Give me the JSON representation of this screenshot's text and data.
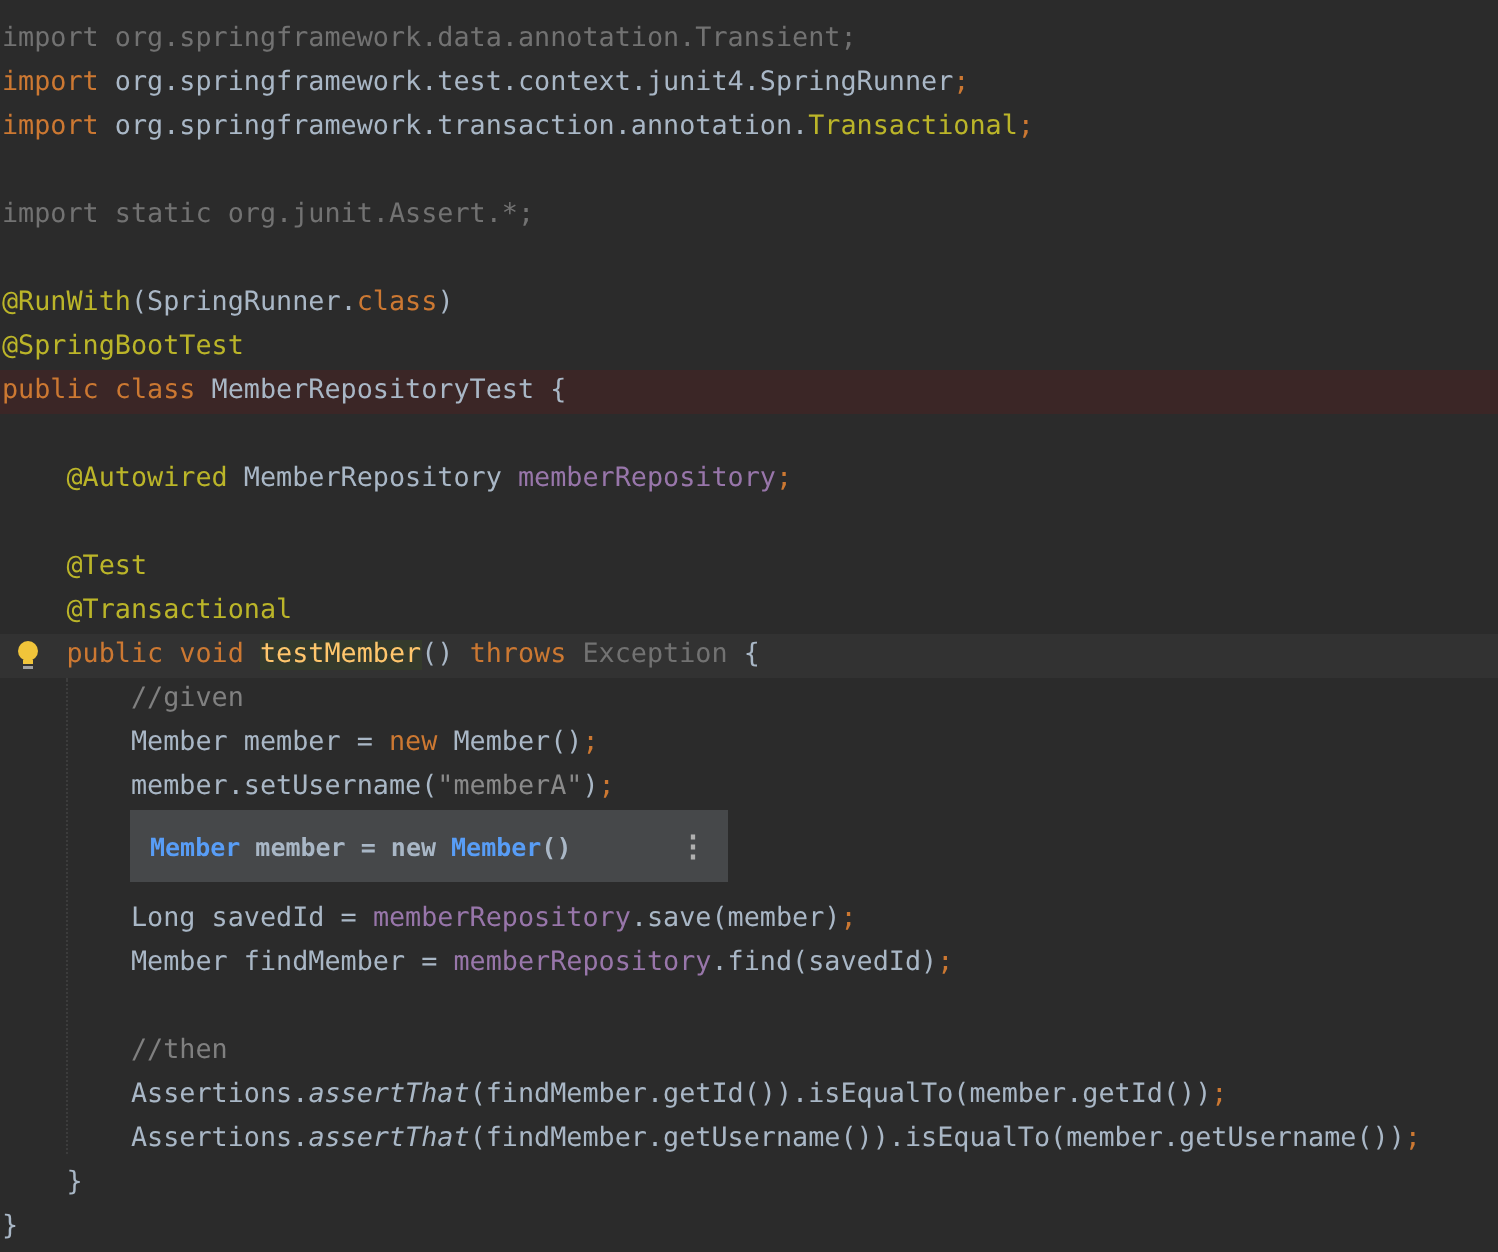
{
  "editor": {
    "lines": [
      {
        "kind": "code",
        "tokens": [
          {
            "kind": "unused",
            "text": "import org.springframework.data.annotation.Transient;"
          }
        ]
      },
      {
        "kind": "code",
        "tokens": [
          {
            "kind": "keyword",
            "text": "import"
          },
          {
            "kind": "plain",
            "text": " org.springframework.test.context.junit4.SpringRunner"
          },
          {
            "kind": "keyword",
            "text": ";"
          }
        ]
      },
      {
        "kind": "code",
        "tokens": [
          {
            "kind": "keyword",
            "text": "import"
          },
          {
            "kind": "plain",
            "text": " org.springframework.transaction.annotation."
          },
          {
            "kind": "class-ref",
            "text": "Transactional"
          },
          {
            "kind": "keyword",
            "text": ";"
          }
        ]
      },
      {
        "kind": "blank"
      },
      {
        "kind": "code",
        "tokens": [
          {
            "kind": "unused",
            "text": "import static org.junit.Assert.*;"
          }
        ]
      },
      {
        "kind": "blank"
      },
      {
        "kind": "code",
        "tokens": [
          {
            "kind": "annotation",
            "text": "@RunWith"
          },
          {
            "kind": "plain",
            "text": "(SpringRunner."
          },
          {
            "kind": "keyword",
            "text": "class"
          },
          {
            "kind": "plain",
            "text": ")"
          }
        ]
      },
      {
        "kind": "code",
        "tokens": [
          {
            "kind": "annotation",
            "text": "@SpringBootTest"
          }
        ]
      },
      {
        "kind": "error-line",
        "tokens": [
          {
            "kind": "keyword",
            "text": "public class"
          },
          {
            "kind": "plain",
            "text": " MemberRepositoryTest {"
          }
        ]
      },
      {
        "kind": "blank"
      },
      {
        "kind": "code",
        "tokens": [
          {
            "kind": "annotation",
            "text": "    @Autowired"
          },
          {
            "kind": "plain",
            "text": " MemberRepository "
          },
          {
            "kind": "field",
            "text": "memberRepository"
          },
          {
            "kind": "keyword",
            "text": ";"
          }
        ]
      },
      {
        "kind": "blank"
      },
      {
        "kind": "code",
        "tokens": [
          {
            "kind": "annotation",
            "text": "    @Test"
          }
        ]
      },
      {
        "kind": "code",
        "tokens": [
          {
            "kind": "annotation",
            "text": "    @Transactional"
          }
        ]
      },
      {
        "kind": "current-line",
        "tokens": [
          {
            "kind": "keyword",
            "text": "    public void "
          },
          {
            "kind": "method-declaration",
            "text": "testMember"
          },
          {
            "kind": "plain",
            "text": "() "
          },
          {
            "kind": "keyword",
            "text": "throws "
          },
          {
            "kind": "unused",
            "text": "Exception"
          },
          {
            "kind": "plain",
            "text": " {"
          }
        ]
      },
      {
        "kind": "code",
        "tokens": [
          {
            "kind": "comment",
            "text": "        //given"
          }
        ]
      },
      {
        "kind": "code",
        "tokens": [
          {
            "kind": "plain",
            "text": "        Member member = "
          },
          {
            "kind": "keyword",
            "text": "new"
          },
          {
            "kind": "plain",
            "text": " Member()"
          },
          {
            "kind": "keyword",
            "text": ";"
          }
        ]
      },
      {
        "kind": "code",
        "tokens": [
          {
            "kind": "plain",
            "text": "        member.setUsername("
          },
          {
            "kind": "string",
            "text": "\"memberA\""
          },
          {
            "kind": "plain",
            "text": ")"
          },
          {
            "kind": "keyword",
            "text": ";"
          }
        ]
      },
      {
        "kind": "blank"
      },
      {
        "kind": "blank"
      },
      {
        "kind": "code",
        "tokens": [
          {
            "kind": "plain",
            "text": "        Long savedId = "
          },
          {
            "kind": "field",
            "text": "memberRepository"
          },
          {
            "kind": "plain",
            "text": ".save(member)"
          },
          {
            "kind": "keyword",
            "text": ";"
          }
        ]
      },
      {
        "kind": "code",
        "tokens": [
          {
            "kind": "plain",
            "text": "        Member findMember = "
          },
          {
            "kind": "field",
            "text": "memberRepository"
          },
          {
            "kind": "plain",
            "text": ".find(savedId)"
          },
          {
            "kind": "keyword",
            "text": ";"
          }
        ]
      },
      {
        "kind": "blank"
      },
      {
        "kind": "code",
        "tokens": [
          {
            "kind": "comment",
            "text": "        //then"
          }
        ]
      },
      {
        "kind": "code",
        "tokens": [
          {
            "kind": "plain",
            "text": "        Assertions."
          },
          {
            "kind": "static-call",
            "text": "assertThat"
          },
          {
            "kind": "plain",
            "text": "(findMember.getId()).isEqualTo(member.getId())"
          },
          {
            "kind": "keyword",
            "text": ";"
          }
        ]
      },
      {
        "kind": "code",
        "tokens": [
          {
            "kind": "plain",
            "text": "        Assertions."
          },
          {
            "kind": "static-call",
            "text": "assertThat"
          },
          {
            "kind": "plain",
            "text": "(findMember.getUsername()).isEqualTo(member.getUsername())"
          },
          {
            "kind": "keyword",
            "text": ";"
          }
        ]
      },
      {
        "kind": "code",
        "tokens": [
          {
            "kind": "plain",
            "text": "    }"
          }
        ]
      },
      {
        "kind": "code",
        "tokens": [
          {
            "kind": "plain",
            "text": "}"
          }
        ]
      }
    ]
  },
  "popup": {
    "tokens": [
      {
        "kind": "type",
        "text": "Member"
      },
      {
        "kind": "plain",
        "text": " member = new "
      },
      {
        "kind": "type",
        "text": "Member"
      },
      {
        "kind": "plain",
        "text": "()"
      }
    ],
    "menu": "⋮"
  }
}
